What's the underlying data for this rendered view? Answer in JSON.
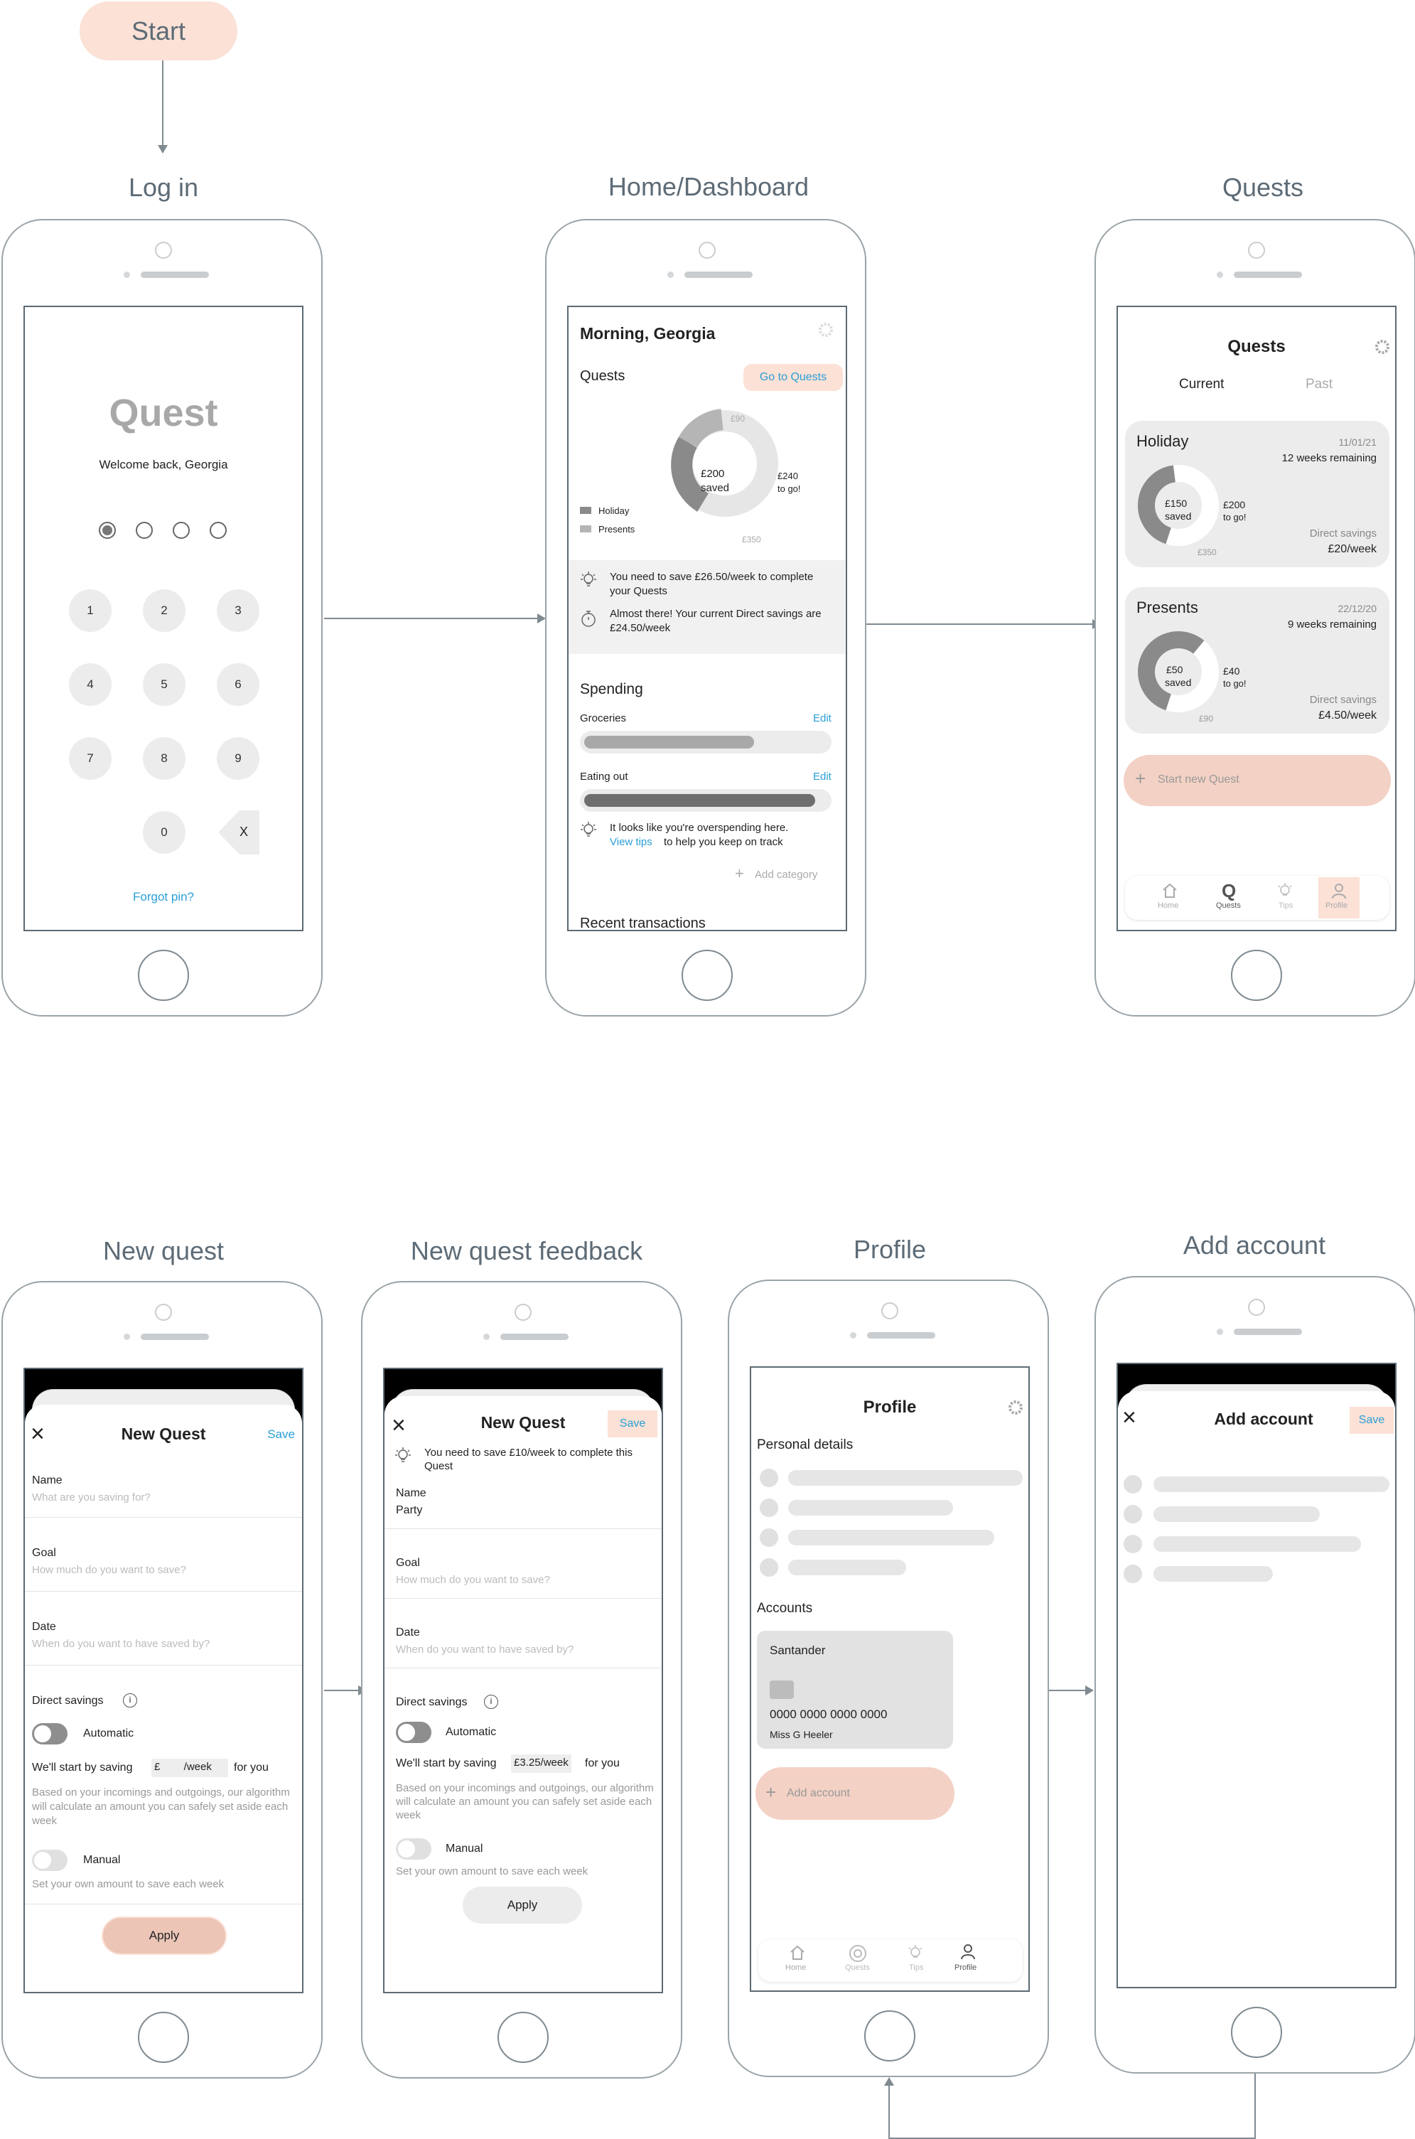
{
  "start": "Start",
  "titles": {
    "login": "Log in",
    "home": "Home/Dashboard",
    "quests": "Quests",
    "newquest": "New quest",
    "feedback": "New quest feedback",
    "profile": "Profile",
    "addaccount": "Add account"
  },
  "colors": {
    "accent": "#fbe1d6",
    "link": "#2a9fd6",
    "connector": "#7f8a91"
  },
  "login": {
    "logo": "Quest",
    "welcome": "Welcome back, Georgia",
    "pin_filled": 1,
    "pin_total": 4,
    "keys": [
      "1",
      "2",
      "3",
      "4",
      "5",
      "6",
      "7",
      "8",
      "9",
      "0",
      "X"
    ],
    "forgot": "Forgot pin?"
  },
  "home": {
    "greeting": "Morning, Georgia",
    "quests_heading": "Quests",
    "goto_button": "Go to Quests",
    "donut": {
      "saved_amount": "£200",
      "saved_word": "saved",
      "togo_amount": "£240",
      "togo_word": "to go!",
      "label_top": "£90",
      "label_bottom": "£350"
    },
    "legend": [
      "Holiday",
      "Presents"
    ],
    "tip1": "You need to save £26.50/week to complete your Quests",
    "tip2": "Almost there! Your current Direct savings are £24.50/week",
    "spending_heading": "Spending",
    "categories": [
      {
        "name": "Groceries",
        "edit": "Edit",
        "level": 0.7
      },
      {
        "name": "Eating out",
        "edit": "Edit",
        "level": 0.95
      }
    ],
    "overspend_tip_a": "It looks like you're overspending here.",
    "overspend_link": "View tips",
    "overspend_tip_b": "to help you keep on track",
    "add_category": "Add category",
    "recent": "Recent transactions"
  },
  "quests": {
    "title": "Quests",
    "tabs": [
      "Current",
      "Past"
    ],
    "cards": [
      {
        "name": "Holiday",
        "date": "11/01/21",
        "remaining": "12 weeks remaining",
        "saved": "£150",
        "saved_word": "saved",
        "togo": "£200",
        "togo_word": "to go!",
        "total": "£350",
        "ds_label": "Direct savings",
        "ds_value": "£20/week",
        "progress": 0.43
      },
      {
        "name": "Presents",
        "date": "22/12/20",
        "remaining": "9 weeks remaining",
        "saved": "£50",
        "saved_word": "saved",
        "togo": "£40",
        "togo_word": "to go!",
        "total": "£90",
        "ds_label": "Direct savings",
        "ds_value": "£4.50/week",
        "progress": 0.56
      }
    ],
    "start_new": "Start new Quest",
    "nav": [
      "Home",
      "Quests",
      "Tips",
      "Profile"
    ]
  },
  "newquest": {
    "title": "New Quest",
    "save": "Save",
    "name_label": "Name",
    "name_placeholder": "What are you saving for?",
    "goal_label": "Goal",
    "goal_placeholder": "How much do you want to save?",
    "date_label": "Date",
    "date_placeholder": "When do you want to have saved by?",
    "direct": "Direct savings",
    "automatic": "Automatic",
    "start_a": "We'll start by saving",
    "amount_placeholder": "£        /week",
    "start_b": "for you",
    "algo": "Based on your incomings and outgoings, our algorithm will calculate an amount you can safely set aside each week",
    "manual": "Manual",
    "manual_desc": "Set your own amount to save each week",
    "apply": "Apply"
  },
  "feedback": {
    "title": "New Quest",
    "save": "Save",
    "tip": "You need to save £10/week to complete this Quest",
    "name_label": "Name",
    "name_value": "Party",
    "goal_label": "Goal",
    "goal_placeholder": "How much do you want to save?",
    "date_label": "Date",
    "date_placeholder": "When do you want to have saved by?",
    "direct": "Direct savings",
    "automatic": "Automatic",
    "start_a": "We'll start by saving",
    "amount": "£3.25/week",
    "start_b": "for you",
    "algo": "Based on your incomings and outgoings, our algorithm will calculate an amount you can safely set aside each week",
    "manual": "Manual",
    "manual_desc": "Set your own amount to save each week",
    "apply": "Apply"
  },
  "profile": {
    "title": "Profile",
    "personal": "Personal details",
    "accounts": "Accounts",
    "bank": "Santander",
    "card_number": "0000 0000 0000 0000",
    "card_holder": "Miss G Heeler",
    "add_account": "Add account",
    "nav": [
      "Home",
      "Quests",
      "Tips",
      "Profile"
    ]
  },
  "addaccount": {
    "title": "Add account",
    "save": "Save"
  }
}
